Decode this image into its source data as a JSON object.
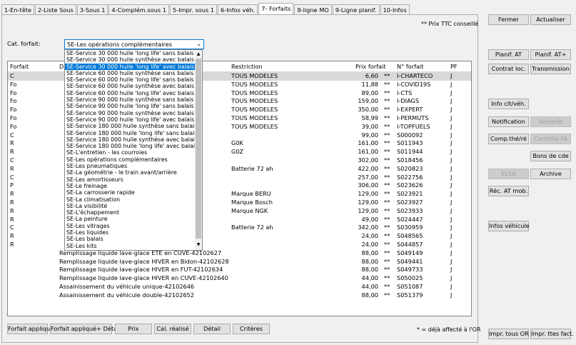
{
  "tabs": [
    {
      "label": "1-En-tête",
      "active": false
    },
    {
      "label": "2-Liste Sous",
      "active": false
    },
    {
      "label": "3-Sous 1",
      "active": false
    },
    {
      "label": "4-Complém.sous 1",
      "active": false
    },
    {
      "label": "5-Impr. sous 1",
      "active": false
    },
    {
      "label": "6-Infos véh.",
      "active": false
    },
    {
      "label": "7- Forfaits",
      "active": true
    },
    {
      "label": "8-ligne MO",
      "active": false
    },
    {
      "label": "9-Ligne planif.",
      "active": false
    },
    {
      "label": "10-Infos",
      "active": false
    }
  ],
  "note_prix": "** Prix TTC conseillé",
  "cat_label": "Cat. forfait:",
  "cat_value": "SE-Les opérations complémentaires",
  "dropdown_items": [
    "SE-Service 30 000 huile 'long life' sans balais",
    "SE-Service 30 000 huile synthèse avec balais",
    "SE-Service 30 000 huile 'long life' avec balais",
    "SE-Service 60 000 huile synthèse sans balais",
    "SE-Service 60 000 huile 'long life' sans balais",
    "SE-Service 60 000 huile synthèse avec balais",
    "SE-Service 60 000 huile 'long life' avec balais",
    "SE-Service 90 000 huile synthèse sans balais",
    "SE-Service 90 000 huile 'long life' sans balais",
    "SE-Service 90 000 huile synthèse avec balais",
    "SE-Service 90 000 huile 'long life' avec balais",
    "SE-Service 180 000 huile synthèse sans balais",
    "SE-Service 180 000 huile 'long life' sans balais",
    "SE-Service 180 000 huile synthèse avec balais",
    "SE-Service 180 000 huile 'long life' avec balais",
    "SE-L'entretien - les courroies",
    "SE-Les opérations complémentaires",
    "SE-Les pneumatiques",
    "SE-La géométrie - le train avant/arrière",
    "SE-Les amortisseurs",
    "SE-Le freinage",
    "SE-La carrosserie rapide",
    "SE-La climatisation",
    "SE-La visibilité",
    "SE-L'échappement",
    "SE-La peinture",
    "SE-Les vitrages",
    "SE-Les liquides",
    "SE-Les balais",
    "SE-Les kits"
  ],
  "dropdown_highlight_index": 2,
  "table": {
    "headers": {
      "forfait": "Forfait",
      "designation": "D",
      "restriction": "Restriction",
      "prix": "Prix forfait",
      "no": "N° forfait",
      "pf": "PF"
    },
    "rows": [
      {
        "forfait": "C",
        "designation": "",
        "restriction": "TOUS MODELES",
        "prix": "6,60",
        "mark": "**",
        "no": "I-CHARTECO",
        "pf": "J"
      },
      {
        "forfait": "Fo",
        "designation": "",
        "restriction": "TOUS MODELES",
        "prix": "11,88",
        "mark": "**",
        "no": "I-COVID19S",
        "pf": "J"
      },
      {
        "forfait": "Fo",
        "designation": "",
        "restriction": "TOUS MODELES",
        "prix": "89,00",
        "mark": "**",
        "no": "I-CTS",
        "pf": "J"
      },
      {
        "forfait": "Fo",
        "designation": "",
        "restriction": "TOUS MODELES",
        "prix": "159,00",
        "mark": "**",
        "no": "I-DIAGS",
        "pf": "J"
      },
      {
        "forfait": "Fo",
        "designation": "",
        "restriction": "TOUS MODELES",
        "prix": "350,00",
        "mark": "**",
        "no": "I-EXPERT",
        "pf": "J"
      },
      {
        "forfait": "Fo",
        "designation": "",
        "restriction": "TOUS MODELES",
        "prix": "58,99",
        "mark": "**",
        "no": "I-PERMUTS",
        "pf": "J"
      },
      {
        "forfait": "Fo",
        "designation": "",
        "restriction": "TOUS MODELES",
        "prix": "39,00",
        "mark": "**",
        "no": "I-TOPFUELS",
        "pf": "J"
      },
      {
        "forfait": "C",
        "designation": "",
        "restriction": "",
        "prix": "99,00",
        "mark": "**",
        "no": "S000092",
        "pf": "J"
      },
      {
        "forfait": "R",
        "designation": "",
        "restriction": "G0K",
        "prix": "161,00",
        "mark": "**",
        "no": "S011943",
        "pf": "J"
      },
      {
        "forfait": "R",
        "designation": "",
        "restriction": "G0Z",
        "prix": "161,00",
        "mark": "**",
        "no": "S011944",
        "pf": "J"
      },
      {
        "forfait": "C",
        "designation": "",
        "restriction": "",
        "prix": "302,00",
        "mark": "**",
        "no": "S018456",
        "pf": "J"
      },
      {
        "forfait": "R",
        "designation": "",
        "restriction": "Batterie 72 ah",
        "prix": "422,00",
        "mark": "**",
        "no": "S020823",
        "pf": "J"
      },
      {
        "forfait": "C",
        "designation": "",
        "restriction": "",
        "prix": "257,00",
        "mark": "**",
        "no": "S022756",
        "pf": "J"
      },
      {
        "forfait": "P",
        "designation": "",
        "restriction": "",
        "prix": "306,00",
        "mark": "**",
        "no": "S023626",
        "pf": "J"
      },
      {
        "forfait": "R",
        "designation": "",
        "restriction": "Marque BERU",
        "prix": "129,00",
        "mark": "**",
        "no": "S023921",
        "pf": "J"
      },
      {
        "forfait": "R",
        "designation": "",
        "restriction": "Marque Bosch",
        "prix": "129,00",
        "mark": "**",
        "no": "S023927",
        "pf": "J"
      },
      {
        "forfait": "R",
        "designation": "",
        "restriction": "Marque NGK",
        "prix": "129,00",
        "mark": "**",
        "no": "S023933",
        "pf": "J"
      },
      {
        "forfait": "R",
        "designation": "",
        "restriction": "",
        "prix": "49,00",
        "mark": "**",
        "no": "S024447",
        "pf": "J"
      },
      {
        "forfait": "C",
        "designation": "",
        "restriction": "Batterie 72 ah",
        "prix": "342,00",
        "mark": "**",
        "no": "S030959",
        "pf": "J"
      },
      {
        "forfait": "R",
        "designation": "",
        "restriction": "",
        "prix": "24,00",
        "mark": "**",
        "no": "S048565",
        "pf": "J"
      },
      {
        "forfait": "R",
        "designation": "",
        "restriction": "",
        "prix": "24,00",
        "mark": "**",
        "no": "S044857",
        "pf": "J"
      },
      {
        "forfait": "",
        "designation": "Remplissage liquide  lave-glace  ETE  en CUVE-42102627",
        "restriction": "",
        "prix": "88,00",
        "mark": "**",
        "no": "S049149",
        "pf": "J"
      },
      {
        "forfait": "",
        "designation": "Remplissage liquide  lave-glace  HIVER  en Bidon-42102628",
        "restriction": "",
        "prix": "88,00",
        "mark": "**",
        "no": "S049441",
        "pf": "J"
      },
      {
        "forfait": "",
        "designation": "Remplissage liquide  lave-glace  HIVER  en FUT-42102634",
        "restriction": "",
        "prix": "88,00",
        "mark": "**",
        "no": "S049733",
        "pf": "J"
      },
      {
        "forfait": "",
        "designation": "Remplissage liquide  lave-glace  HIVER  en CUVE-42102640",
        "restriction": "",
        "prix": "44,00",
        "mark": "**",
        "no": "S050025",
        "pf": "J"
      },
      {
        "forfait": "",
        "designation": "Assainissement du véhicule unique-42102646",
        "restriction": "",
        "prix": "44,00",
        "mark": "**",
        "no": "S051087",
        "pf": "J"
      },
      {
        "forfait": "",
        "designation": "Assainissement du véhicule double-42102652",
        "restriction": "",
        "prix": "88,00",
        "mark": "**",
        "no": "S051379",
        "pf": "J"
      }
    ]
  },
  "bottom_buttons": [
    "Forfait appliqué",
    "Forfait appliqué+ Détail",
    "Prix",
    "Cal. réalisé",
    "Détail",
    "Critères"
  ],
  "note_bottom": "* = déjà affecté à l'OR",
  "right_buttons": {
    "fermer": "Fermer",
    "actualiser": "Actualiser",
    "planif_at": "Planif. AT",
    "planif_at_plus": "Planif. AT+",
    "contrat_loc": "Contrat loc.",
    "transmission": "Transmission",
    "info_clt": "Info clt/véh.",
    "notification": "Notification",
    "veh_pret": "Véh/prêt",
    "comp_the": "Comp.thé/ré",
    "controle_fa": "Contrôle FA",
    "bons_cde": "Bons de cde",
    "elsa": "ELSA",
    "archive": "Archive",
    "rec_at": "Réc. AT mob.",
    "infos_vehicule": "Infos véhicule",
    "impr_tous_or": "Impr. tous OR",
    "impr_ttes_fact": "Impr. ttes fact."
  }
}
